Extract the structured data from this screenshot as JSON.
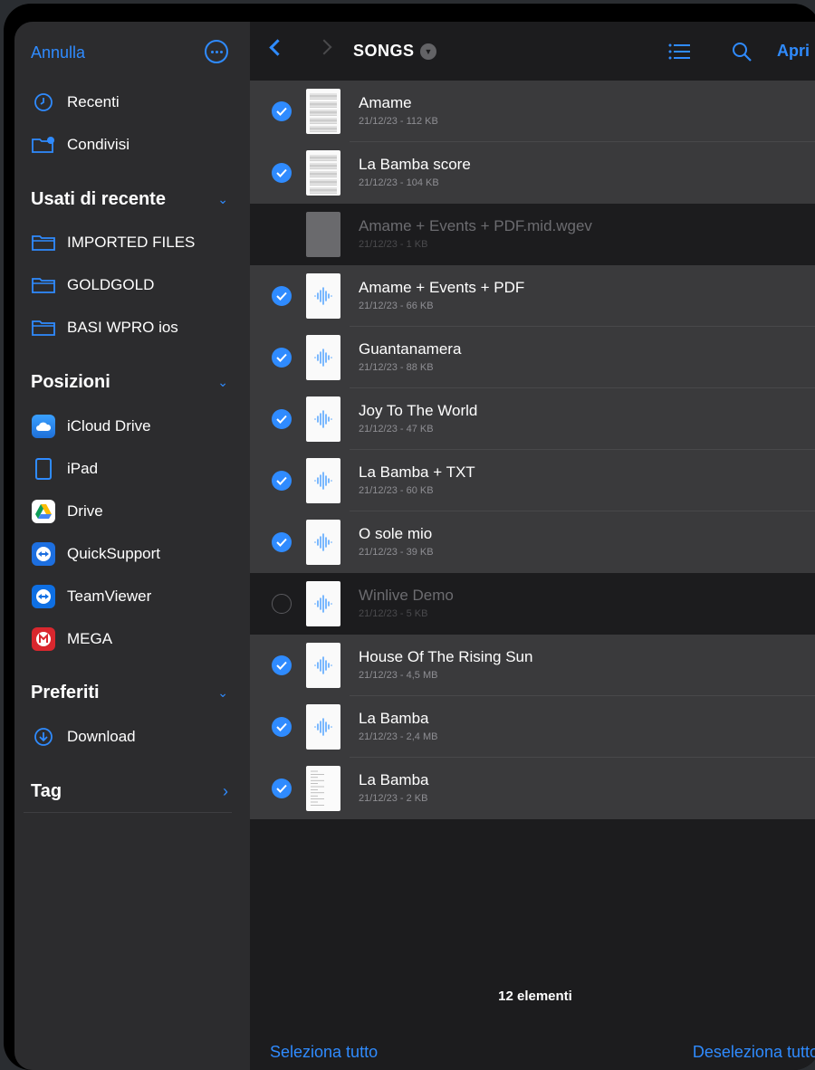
{
  "sidebar": {
    "cancel_label": "Annulla",
    "items_top": [
      {
        "label": "Recenti",
        "icon": "clock-icon"
      },
      {
        "label": "Condivisi",
        "icon": "shared-folder-icon"
      }
    ],
    "recent_header": "Usati di recente",
    "recent_folders": [
      {
        "label": "IMPORTED FILES",
        "icon": "folder-icon"
      },
      {
        "label": "GOLDGOLD",
        "icon": "folder-icon"
      },
      {
        "label": "BASI WPRO ios",
        "icon": "folder-icon"
      }
    ],
    "locations_header": "Posizioni",
    "locations": [
      {
        "label": "iCloud Drive",
        "icon": "icloud-icon"
      },
      {
        "label": "iPad",
        "icon": "ipad-icon"
      },
      {
        "label": "Drive",
        "icon": "google-drive-icon"
      },
      {
        "label": "QuickSupport",
        "icon": "quicksupport-icon"
      },
      {
        "label": "TeamViewer",
        "icon": "teamviewer-icon"
      },
      {
        "label": "MEGA",
        "icon": "mega-icon"
      }
    ],
    "favorites_header": "Preferiti",
    "favorites": [
      {
        "label": "Download",
        "icon": "download-icon"
      }
    ],
    "tags_header": "Tag"
  },
  "toolbar": {
    "folder_title": "SONGS",
    "open_label": "Apri"
  },
  "files": [
    {
      "name": "Amame",
      "meta": "21/12/23 - 112 KB",
      "selected": true,
      "thumb": "score"
    },
    {
      "name": "La Bamba score",
      "meta": "21/12/23 - 104 KB",
      "selected": true,
      "thumb": "score"
    },
    {
      "name": "Amame + Events + PDF.mid.wgev",
      "meta": "21/12/23 - 1 KB",
      "selected": false,
      "disabled": true,
      "thumb": "grey"
    },
    {
      "name": "Amame + Events + PDF",
      "meta": "21/12/23 - 66 KB",
      "selected": true,
      "thumb": "audio"
    },
    {
      "name": "Guantanamera",
      "meta": "21/12/23 - 88 KB",
      "selected": true,
      "thumb": "audio"
    },
    {
      "name": "Joy To The World",
      "meta": "21/12/23 - 47 KB",
      "selected": true,
      "thumb": "audio"
    },
    {
      "name": "La Bamba + TXT",
      "meta": "21/12/23 - 60 KB",
      "selected": true,
      "thumb": "audio"
    },
    {
      "name": "O sole mio",
      "meta": "21/12/23 - 39 KB",
      "selected": true,
      "thumb": "audio"
    },
    {
      "name": "Winlive Demo",
      "meta": "21/12/23 - 5 KB",
      "selected": false,
      "thumb": "audio"
    },
    {
      "name": "House Of The Rising Sun",
      "meta": "21/12/23 - 4,5 MB",
      "selected": true,
      "thumb": "audio"
    },
    {
      "name": "La Bamba",
      "meta": "21/12/23 - 2,4 MB",
      "selected": true,
      "thumb": "audio"
    },
    {
      "name": "La Bamba",
      "meta": "21/12/23 - 2 KB",
      "selected": true,
      "thumb": "text"
    }
  ],
  "footer": {
    "count": "12 elementi",
    "select_all": "Seleziona tutto",
    "deselect_all": "Deseleziona tutto"
  },
  "colors": {
    "accent": "#2f8bff",
    "selected_row": "#3a3a3c",
    "background": "#1c1c1e"
  }
}
